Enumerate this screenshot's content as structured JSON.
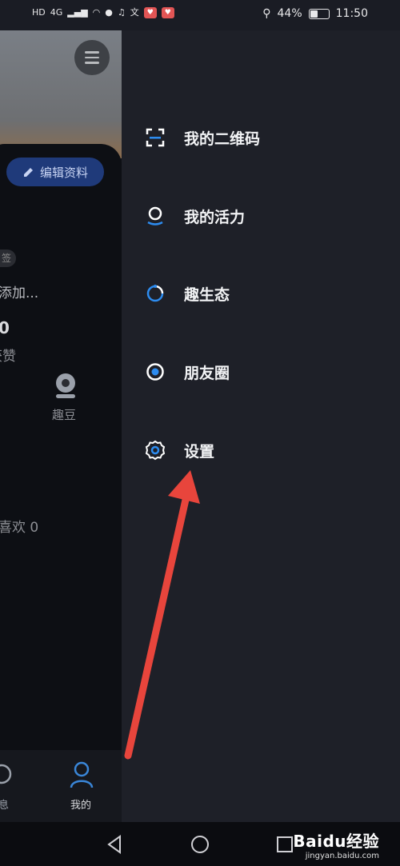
{
  "status_bar": {
    "left_labels": [
      "HD",
      "4G"
    ],
    "battery_percent": "44%",
    "battery_level": 0.44,
    "time": "11:50"
  },
  "profile_background": {
    "edit_button_label": "编辑资料",
    "tag_text": "签",
    "add_text": "添加...",
    "count_value": "0",
    "likes_label": "获赞",
    "qudou_label": "趣豆",
    "liked_text": "喜欢 0",
    "nav_messages_label": "息",
    "nav_me_label": "我的"
  },
  "drawer": {
    "items": [
      {
        "label": "我的二维码",
        "icon": "qr-scan-icon"
      },
      {
        "label": "我的活力",
        "icon": "vitality-icon"
      },
      {
        "label": "趣生态",
        "icon": "ecosystem-icon"
      },
      {
        "label": "朋友圈",
        "icon": "moments-icon"
      },
      {
        "label": "设置",
        "icon": "gear-icon"
      }
    ]
  },
  "annotation": {
    "arrow_color": "#e8453c"
  },
  "watermark": {
    "main": "Baidu经验",
    "sub": "jingyan.baidu.com"
  },
  "colors": {
    "accent_blue": "#2d8cf0",
    "drawer_bg": "#1e2028"
  }
}
